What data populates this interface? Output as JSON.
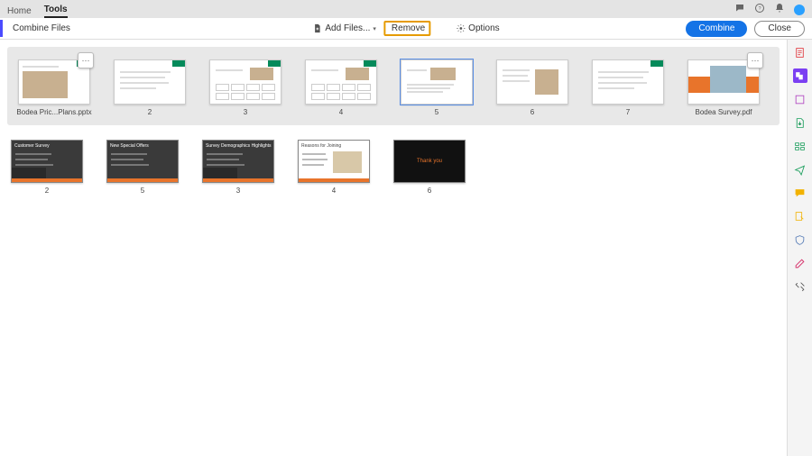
{
  "topbar": {
    "tabs": [
      "Home",
      "Tools"
    ],
    "active_tab": "Tools"
  },
  "toolbar": {
    "title": "Combine Files",
    "add_files_label": "Add Files...",
    "remove_label": "Remove",
    "options_label": "Options",
    "combine_label": "Combine",
    "close_label": "Close"
  },
  "group1": {
    "items": [
      {
        "label": "Bodea Pric...Plans.pptx"
      },
      {
        "label": "2"
      },
      {
        "label": "3"
      },
      {
        "label": "4"
      },
      {
        "label": "5",
        "selected": true
      },
      {
        "label": "6"
      },
      {
        "label": "7"
      },
      {
        "label": "Bodea Survey.pdf"
      }
    ]
  },
  "row2": {
    "items": [
      {
        "label": "2",
        "title": "Customer Survey"
      },
      {
        "label": "5",
        "title": "New Special Offers"
      },
      {
        "label": "3",
        "title": "Survey Demographics Highlights"
      },
      {
        "label": "4",
        "title": "Reasons for Joining",
        "variant": "white"
      },
      {
        "label": "6",
        "title": "Thank you",
        "variant": "black"
      }
    ]
  },
  "icons": {
    "notifications": "notifications-icon",
    "help": "help-icon",
    "chat": "chat-icon",
    "avatar": "user-avatar"
  }
}
